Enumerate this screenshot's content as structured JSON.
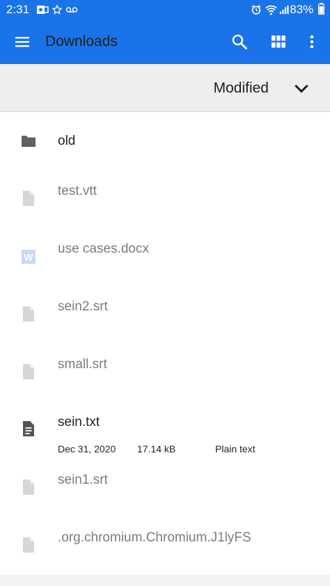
{
  "status_bar": {
    "time": "2:31",
    "battery": "83%",
    "icons": [
      "outlook-icon",
      "star-icon",
      "voicemail-icon",
      "alarm-icon",
      "wifi-icon",
      "signal-icon",
      "battery-icon"
    ]
  },
  "toolbar": {
    "title": "Downloads",
    "icons": [
      "menu-icon",
      "search-icon",
      "grid-view-icon",
      "more-vert-icon"
    ],
    "color": "#1a73e8"
  },
  "sort": {
    "label": "Modified",
    "icon": "chevron-down-icon"
  },
  "files": [
    {
      "name": "old",
      "icon": "folder-icon"
    },
    {
      "name": "test.vtt",
      "icon": "file-icon"
    },
    {
      "name": "use cases.docx",
      "icon": "word-doc-icon"
    },
    {
      "name": "sein2.srt",
      "icon": "file-icon"
    },
    {
      "name": "small.srt",
      "icon": "file-icon"
    },
    {
      "name": "sein.txt",
      "icon": "text-file-icon",
      "date": "Dec 31, 2020",
      "size": "17.14 kB",
      "type": "Plain text"
    },
    {
      "name": "sein1.srt",
      "icon": "file-icon"
    },
    {
      "name": ".org.chromium.Chromium.J1lyFS",
      "icon": "file-icon"
    }
  ]
}
